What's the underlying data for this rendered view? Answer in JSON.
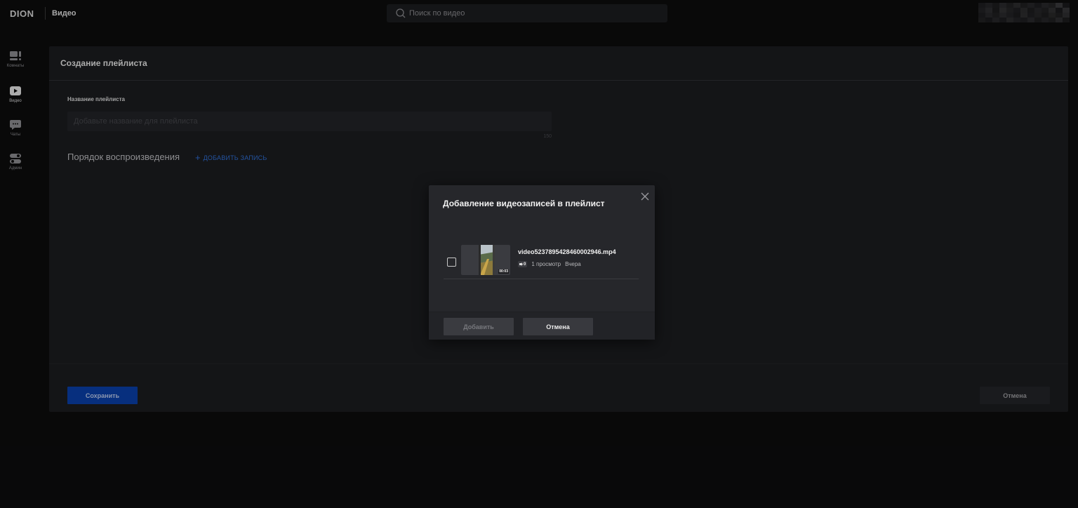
{
  "header": {
    "logo": "DION",
    "app_title": "Видео",
    "search_placeholder": "Поиск по видео",
    "search_icon": "search-icon"
  },
  "sidebar": {
    "items": [
      {
        "label": "Комнаты",
        "icon": "rooms-icon",
        "active": false
      },
      {
        "label": "Видео",
        "icon": "video-play-icon",
        "active": true
      },
      {
        "label": "Чаты",
        "icon": "chat-icon",
        "active": false
      },
      {
        "label": "Админ",
        "icon": "toggle-icon",
        "active": false
      }
    ]
  },
  "page": {
    "title": "Создание плейлиста",
    "name_label": "Название плейлиста",
    "name_placeholder": "Добавьте название для плейлиста",
    "name_value": "",
    "char_limit": "150",
    "order_title": "Порядок воспроизведения",
    "add_record_label": "ДОБАВИТЬ ЗАПИСЬ",
    "save_label": "Сохранить",
    "cancel_label": "Отмена"
  },
  "modal": {
    "title": "Добавление видеозаписей в плейлист",
    "videos": [
      {
        "name": "video5237895428460002946.mp4",
        "duration": "00:03",
        "badge": "0",
        "views": "1 просмотр",
        "date": "Вчера",
        "checked": false
      }
    ],
    "add_label": "Добавить",
    "cancel_label": "Отмена"
  },
  "colors": {
    "accent": "#0a3fa8",
    "link": "#2f6fd6",
    "panel_bg": "#1b1c1f",
    "modal_bg": "#26272b"
  }
}
